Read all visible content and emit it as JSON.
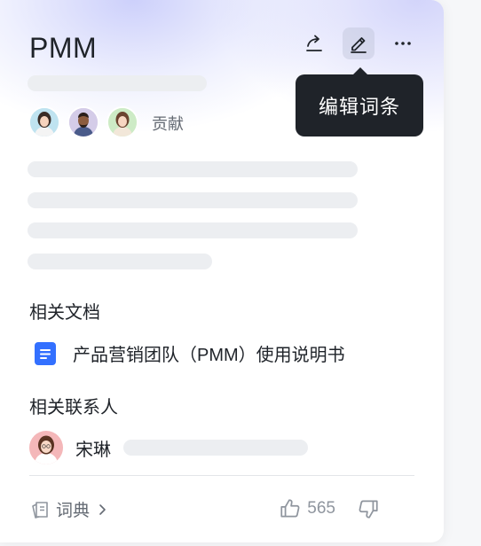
{
  "header": {
    "title": "PMM",
    "tooltip_text": "编辑词条"
  },
  "icons": {
    "share": "share-icon",
    "edit": "edit-icon",
    "more": "more-icon"
  },
  "contributors": {
    "label": "贡献",
    "avatars": [
      "avatar-woman-1",
      "avatar-man",
      "avatar-woman-2"
    ]
  },
  "related_docs": {
    "title": "相关文档",
    "items": [
      {
        "icon": "document-icon",
        "title": "产品营销团队（PMM）使用说明书"
      }
    ]
  },
  "related_contacts": {
    "title": "相关联系人",
    "items": [
      {
        "name": "宋琳"
      }
    ]
  },
  "footer": {
    "dictionary_label": "词典",
    "like_count": "565"
  },
  "colors": {
    "doc_icon_blue": "#3370ff",
    "text_primary": "#1f2329",
    "text_secondary": "#646a73",
    "tooltip_bg": "#1f2329",
    "skeleton": "#eceef1"
  }
}
